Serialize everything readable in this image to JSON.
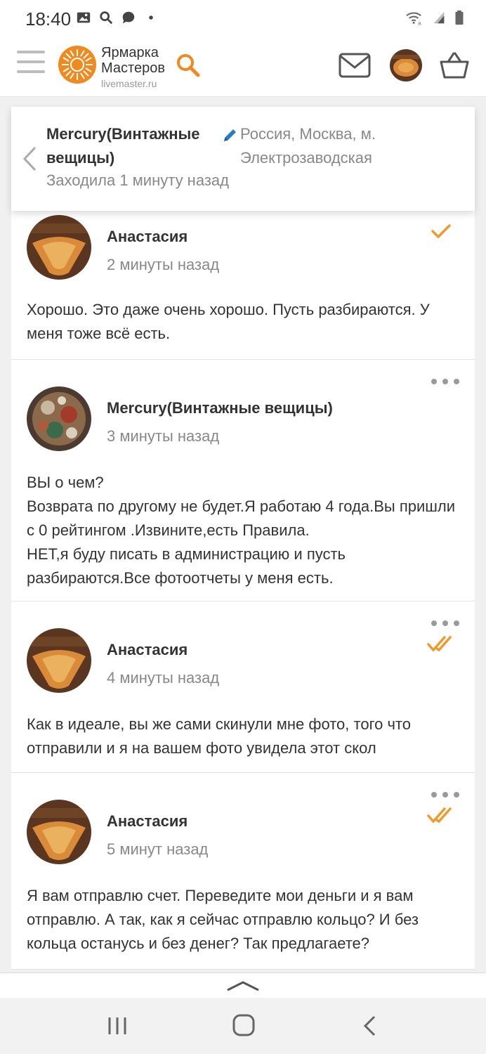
{
  "status_bar": {
    "time": "18:40",
    "left_icons": [
      "image-icon",
      "search-icon",
      "chat-bubble-icon",
      "dot-icon"
    ],
    "right_icons": [
      "wifi-icon",
      "signal-icon",
      "battery-icon"
    ]
  },
  "header": {
    "logo_title_line1": "Ярмарка",
    "logo_title_line2": "Мастеров",
    "logo_subtitle": "livemaster.ru",
    "brand_color": "#f08a1e"
  },
  "contact": {
    "name": "Mercury(Винтажные вещицы)",
    "last_seen": "Заходила 1 минуту назад",
    "location": "Россия, Москва, м. Электрозаводская"
  },
  "messages": [
    {
      "author": "Анастасия",
      "time": "2 минуты назад",
      "text": "Хорошо. Это даже очень хорошо. Пусть разбираются. У меня тоже всё есть.",
      "status_icon": "check-icon"
    },
    {
      "author": "Mercury(Винтажные вещицы)",
      "time": "3 минуты назад",
      "text": "ВЫ о чем?\nВозврата по другому не будет.Я работаю 4 года.Вы пришли с 0 рейтингом .Извините,есть Правила.\nНЕТ,я буду писать в администрацию и пусть разбираются.Все фотоотчеты у меня есть.",
      "status_icon": ""
    },
    {
      "author": "Анастасия",
      "time": "4 минуты назад",
      "text": "Как в идеале, вы же сами скинули мне фото, того что отправили и я на вашем фото увидела этот скол",
      "status_icon": "double-check-icon"
    },
    {
      "author": "Анастасия",
      "time": "5 минут назад",
      "text": "Я вам отправлю счет. Переведите мои деньги и я вам отправлю. А так, как я сейчас отправлю кольцо? И без кольца останусь и без денег? Так предлагаете?",
      "status_icon": "double-check-icon"
    }
  ],
  "colors": {
    "accent": "#f09a2e",
    "text": "#333333",
    "muted": "#888888"
  }
}
